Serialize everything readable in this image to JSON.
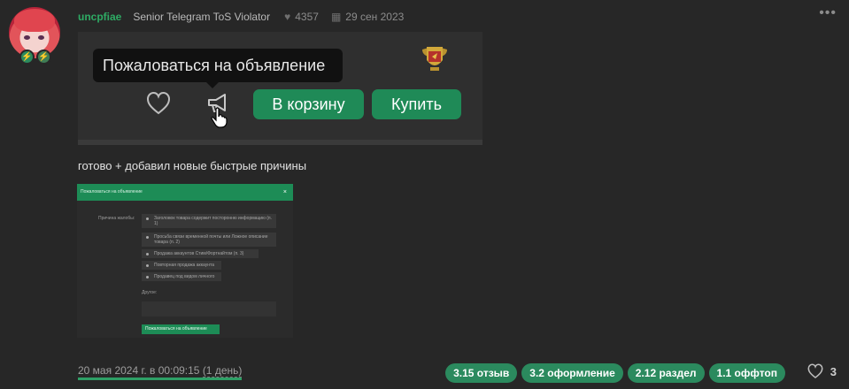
{
  "post": {
    "username": "uncpfiae",
    "user_title": "Senior Telegram ToS Violator",
    "likes_given": "4357",
    "join_date": "29 сен 2023",
    "tooltip": "Пожаловаться на объявление",
    "cart_button": "В корзину",
    "buy_button": "Купить",
    "text": "готово + добавил новые быстрые причины",
    "date": "20 мая 2024 г. в 00:09:15",
    "date_relative": "(1 день)",
    "like_count": "3",
    "tags": [
      "3.15 отзыв",
      "3.2 оформление",
      "2.12 раздел",
      "1.1 оффтоп"
    ]
  },
  "screenshot": {
    "header": "Пожаловаться на объявление",
    "close": "×",
    "label": "Причина жалобы:",
    "reasons": [
      "Заголовок товара содержит посторонню информацию (п. 1)",
      "Просьба связи временной почты или Ложное описание товара (п. 2)",
      "Продажа аккаунтов Cтим/Фортнайтом (п. 3)",
      "Повторная продажа аккаунта",
      "Продавец под видом личного"
    ],
    "other_label": "Другое:",
    "submit": "Пожаловаться на объявление"
  },
  "colors": {
    "accent": "#1f8a57",
    "username": "#2eab64",
    "background": "#272727"
  },
  "icons": [
    "heart-icon",
    "megaphone-icon",
    "hand-cursor-icon",
    "trophy-icon",
    "thumbs-icon",
    "calendar-icon",
    "more-icon"
  ]
}
